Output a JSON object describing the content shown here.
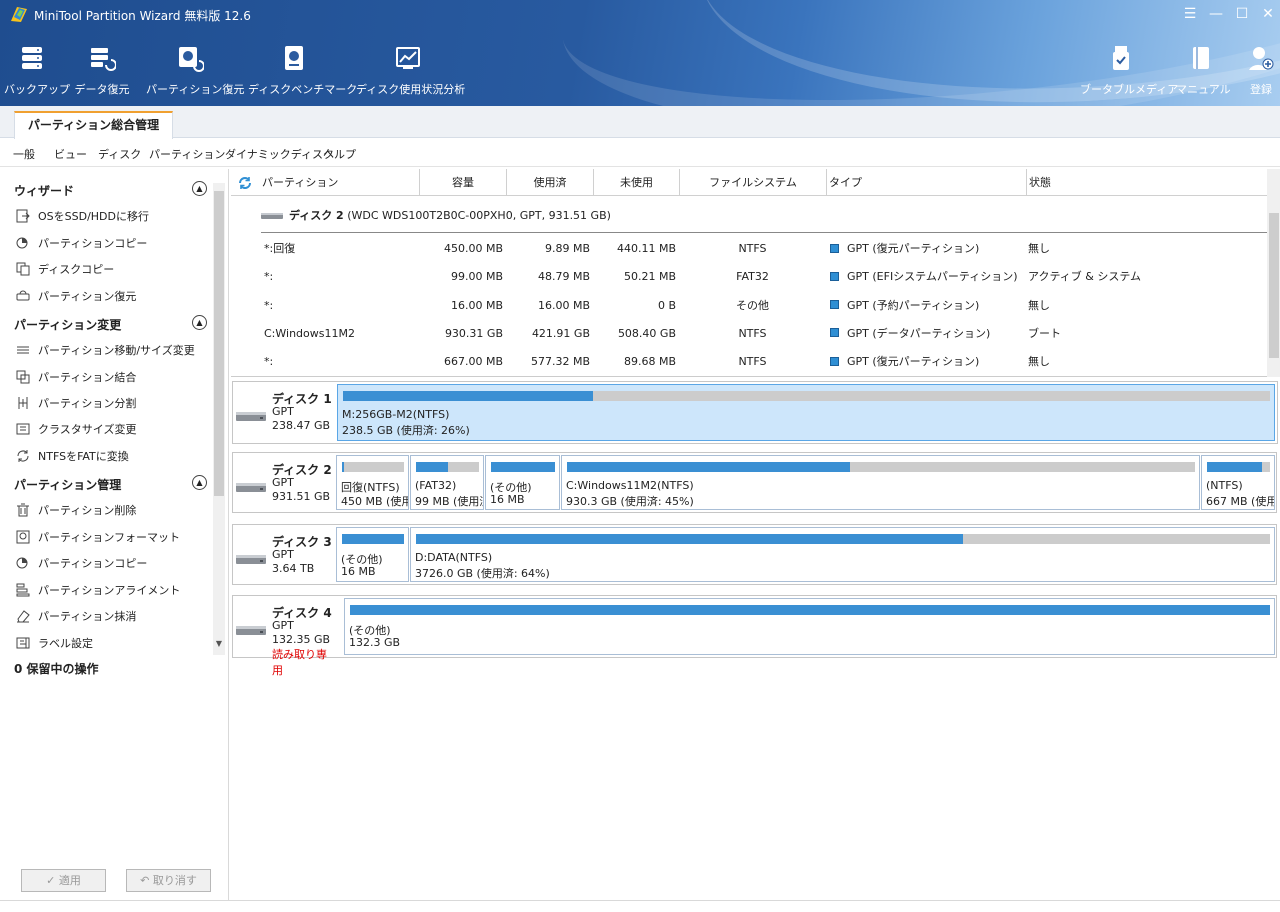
{
  "app": {
    "title": "MiniTool Partition Wizard 無料版 12.6",
    "controls": {
      "settings": "☰",
      "minimize": "—",
      "maximize": "☐",
      "close": "✕"
    }
  },
  "toolbar": {
    "left": [
      {
        "label": "バックアップ",
        "icon": "backup-icon"
      },
      {
        "label": "データ復元",
        "icon": "data-recovery-icon"
      },
      {
        "label": "パーティション復元",
        "icon": "partition-recovery-icon"
      },
      {
        "label": "ディスクベンチマーク",
        "icon": "disk-benchmark-icon"
      },
      {
        "label": "ディスク使用状況分析",
        "icon": "space-analyzer-icon"
      }
    ],
    "right": [
      {
        "label": "ブータブルメディア",
        "icon": "bootable-media-icon"
      },
      {
        "label": "マニュアル",
        "icon": "manual-icon"
      },
      {
        "label": "登録",
        "icon": "register-icon"
      }
    ]
  },
  "tabs": {
    "main": "パーティション総合管理"
  },
  "menu": [
    "一般",
    "ビュー",
    "ディスク",
    "パーティション",
    "ダイナミックディスク",
    "ヘルプ"
  ],
  "sidebar": {
    "sections": [
      {
        "title": "ウィザード",
        "items": [
          "OSをSSD/HDDに移行",
          "パーティションコピー",
          "ディスクコピー",
          "パーティション復元"
        ]
      },
      {
        "title": "パーティション変更",
        "items": [
          "パーティション移動/サイズ変更",
          "パーティション結合",
          "パーティション分割",
          "クラスタサイズ変更",
          "NTFSをFATに変換"
        ]
      },
      {
        "title": "パーティション管理",
        "items": [
          "パーティション削除",
          "パーティションフォーマット",
          "パーティションコピー",
          "パーティションアライメント",
          "パーティション抹消",
          "ラベル設定"
        ]
      }
    ],
    "pending": "0 保留中の操作",
    "apply": "✓ 適用",
    "undo": "↶ 取り消す"
  },
  "table": {
    "headers": [
      "パーティション",
      "容量",
      "使用済",
      "未使用",
      "ファイルシステム",
      "タイプ",
      "状態"
    ],
    "disk_header": {
      "name": "ディスク 2",
      "detail": " (WDC WDS100T2B0C-00PXH0, GPT, 931.51 GB)"
    },
    "rows": [
      {
        "partition": "*:回復",
        "capacity": "450.00 MB",
        "used": "9.89 MB",
        "unused": "440.11 MB",
        "fs": "NTFS",
        "type": "GPT (復元パーティション)",
        "status": "無し"
      },
      {
        "partition": "*:",
        "capacity": "99.00 MB",
        "used": "48.79 MB",
        "unused": "50.21 MB",
        "fs": "FAT32",
        "type": "GPT (EFIシステムパーティション)",
        "status": "アクティブ & システム"
      },
      {
        "partition": "*:",
        "capacity": "16.00 MB",
        "used": "16.00 MB",
        "unused": "0 B",
        "fs": "その他",
        "type": "GPT (予約パーティション)",
        "status": "無し"
      },
      {
        "partition": "C:Windows11M2",
        "capacity": "930.31 GB",
        "used": "421.91 GB",
        "unused": "508.40 GB",
        "fs": "NTFS",
        "type": "GPT (データパーティション)",
        "status": "ブート"
      },
      {
        "partition": "*:",
        "capacity": "667.00 MB",
        "used": "577.32 MB",
        "unused": "89.68 MB",
        "fs": "NTFS",
        "type": "GPT (復元パーティション)",
        "status": "無し"
      }
    ]
  },
  "disks": [
    {
      "name": "ディスク 1",
      "type": "GPT",
      "size": "238.47 GB",
      "readonly": "",
      "partitions": [
        {
          "label": "M:256GB-M2(NTFS)",
          "detail": "238.5 GB (使用済: 26%)",
          "used_fraction": 0.27,
          "selected": true
        }
      ]
    },
    {
      "name": "ディスク 2",
      "type": "GPT",
      "size": "931.51 GB",
      "readonly": "",
      "partitions": [
        {
          "label": "回復(NTFS)",
          "detail": "450 MB (使用",
          "used_fraction": 0.03,
          "selected": false
        },
        {
          "label": "(FAT32)",
          "detail": "99 MB (使用済",
          "used_fraction": 0.5,
          "selected": false
        },
        {
          "label": "(その他)",
          "detail": "16 MB",
          "used_fraction": 1.0,
          "selected": false
        },
        {
          "label": "C:Windows11M2(NTFS)",
          "detail": "930.3 GB (使用済: 45%)",
          "used_fraction": 0.45,
          "selected": false
        },
        {
          "label": "(NTFS)",
          "detail": "667 MB (使用",
          "used_fraction": 0.87,
          "selected": false
        }
      ]
    },
    {
      "name": "ディスク 3",
      "type": "GPT",
      "size": "3.64 TB",
      "readonly": "",
      "partitions": [
        {
          "label": "(その他)",
          "detail": "16 MB",
          "used_fraction": 1.0,
          "selected": false
        },
        {
          "label": "D:DATA(NTFS)",
          "detail": "3726.0 GB (使用済: 64%)",
          "used_fraction": 0.64,
          "selected": false
        }
      ]
    },
    {
      "name": "ディスク 4",
      "type": "GPT",
      "size": "132.35 GB",
      "readonly": "読み取り専用",
      "partitions": [
        {
          "label": "(その他)",
          "detail": "132.3 GB",
          "used_fraction": 1.0,
          "selected": false
        }
      ]
    }
  ],
  "colors": {
    "accent": "#3a8fd3",
    "selected": "#cde6fb",
    "tab_accent": "#f0a030",
    "readonly": "#e00000"
  }
}
